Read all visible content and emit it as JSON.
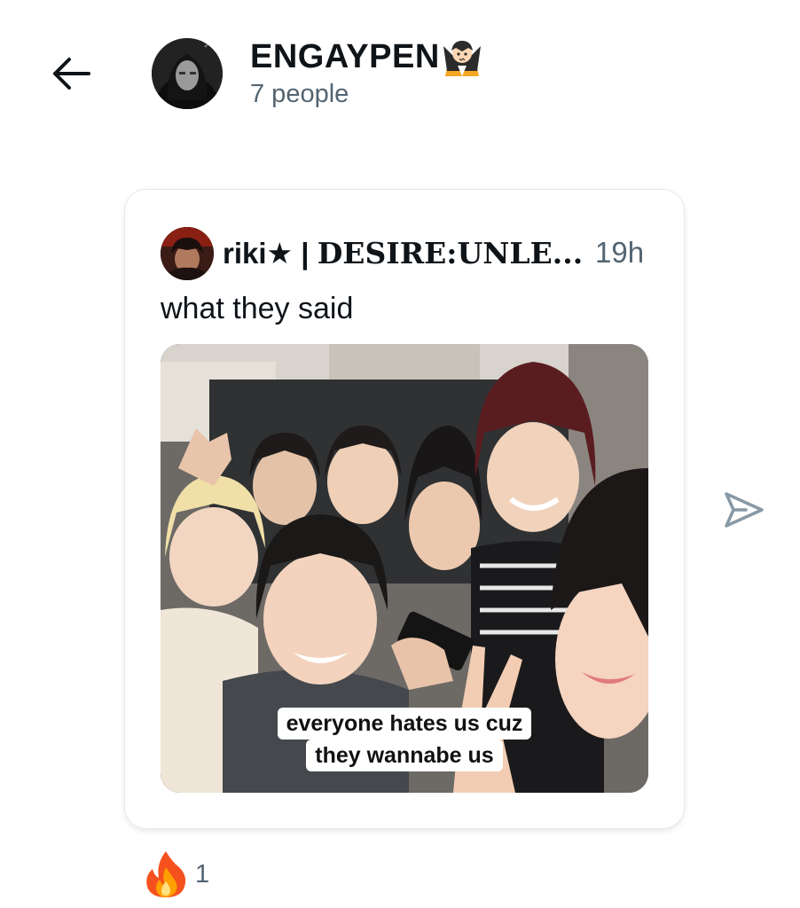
{
  "header": {
    "title": "ENGAYPEN",
    "title_emoji": "vampire-emoji",
    "subtitle": "7 people"
  },
  "post": {
    "author": "riki★ | ",
    "author_styled": "DESIRE:UNLE...",
    "time": "19h",
    "text": "what they said",
    "media_caption_line1": "everyone hates us cuz",
    "media_caption_line2": "they wannabe us"
  },
  "reaction": {
    "emoji": "fire-emoji",
    "count": "1"
  },
  "colors": {
    "text_primary": "#0f1419",
    "text_secondary": "#536471",
    "card_border": "#e6e9ec",
    "send_icon": "#8899a6"
  }
}
